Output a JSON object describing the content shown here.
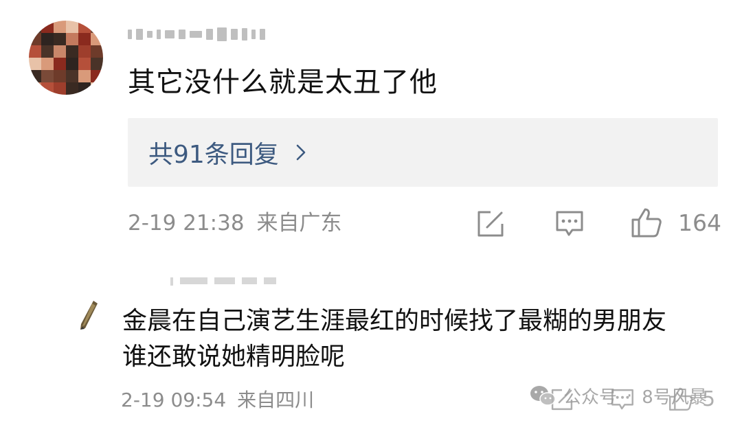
{
  "comments": [
    {
      "text": "其它没什么就是太丑了他",
      "replies_label": "共91条回复",
      "date": "2-19 21:38",
      "location": "来自广东",
      "likes": "164"
    },
    {
      "text_line1": "金晨在自己演艺生涯最红的时候找了最糊的男朋友",
      "text_line2": "谁还敢说她精明脸呢",
      "date": "2-19 09:54",
      "location": "来自四川",
      "likes": "5"
    }
  ],
  "watermark": {
    "prefix": "公众号",
    "name": "8号风暴"
  },
  "icons": {
    "replies_arrow": "chevron-right-icon",
    "share": "edit-share-icon",
    "comment": "comment-bubble-icon",
    "like": "thumbs-up-icon",
    "watermark_logo": "wechat-icon"
  },
  "colors": {
    "reply_link": "#3d5a80",
    "meta_text": "#8c8c8c",
    "reply_box_bg": "#f2f2f2"
  }
}
